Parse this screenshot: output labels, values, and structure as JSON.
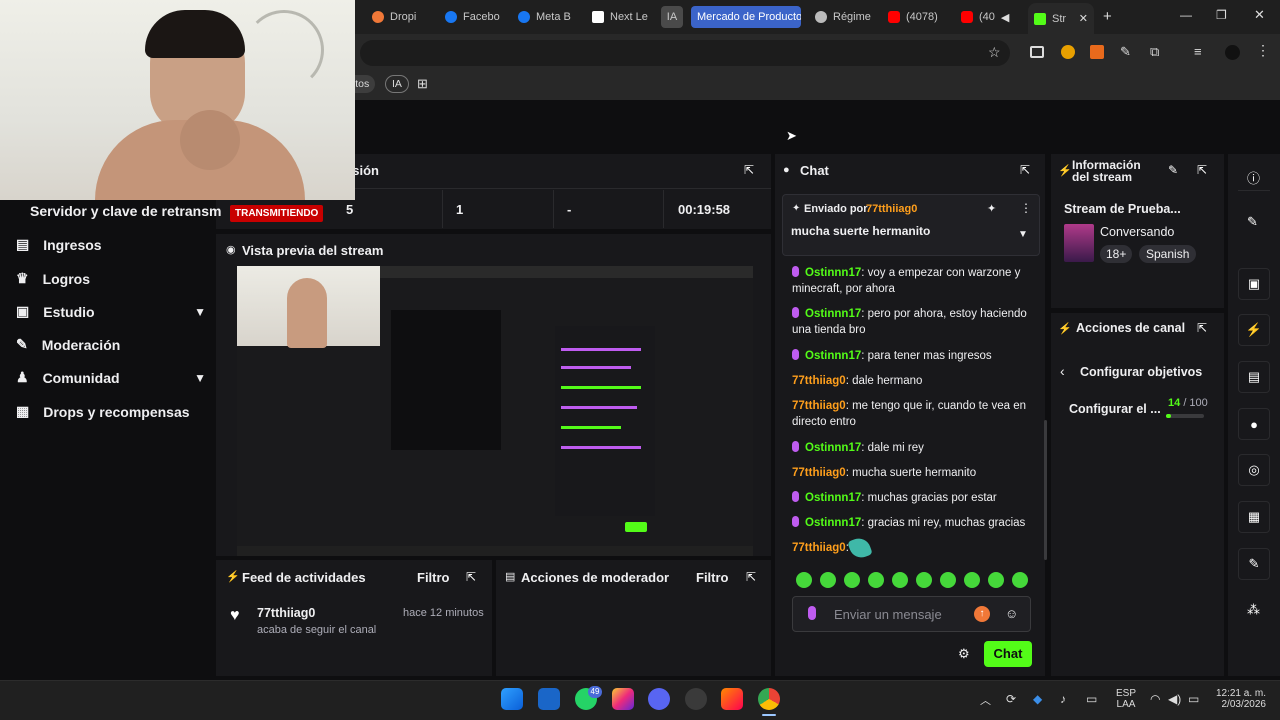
{
  "browser": {
    "tabs": [
      {
        "label": "Dropi",
        "color": "#f07838"
      },
      {
        "label": "Facebo",
        "color": "#1877f2"
      },
      {
        "label": "Meta B",
        "color": "#1877f2"
      },
      {
        "label": "Next Le",
        "color": "#ffffff"
      },
      {
        "label": "IA",
        "color": "#888888"
      },
      {
        "label": "Mercado de Producto",
        "color": "#3b64c9"
      },
      {
        "label": "Régime",
        "color": "#bbbbbb"
      },
      {
        "label": "(4078)",
        "color": "#ff0000"
      },
      {
        "label": "(40",
        "color": "#ff0000"
      },
      {
        "label": "Str",
        "color": "#53fc18"
      }
    ],
    "bookmarks": {
      "item1": "ctos",
      "item2": "IA"
    }
  },
  "session": {
    "title": "esión",
    "server_label": "Servidor y clave de retransm",
    "live_badge": "TRANSMITIENDO",
    "values": [
      "5",
      "1",
      "-",
      "00:19:58"
    ]
  },
  "sidebar": {
    "items": [
      {
        "label": "Ingresos",
        "icon": "coins-icon"
      },
      {
        "label": "Logros",
        "icon": "trophy-icon"
      },
      {
        "label": "Estudio",
        "icon": "studio-icon"
      },
      {
        "label": "Moderación",
        "icon": "wrench-icon"
      },
      {
        "label": "Comunidad",
        "icon": "community-icon"
      },
      {
        "label": "Drops y recompensas",
        "icon": "gift-icon"
      }
    ]
  },
  "preview": {
    "title": "Vista previa del stream"
  },
  "activity": {
    "title": "Feed de actividades",
    "filter": "Filtro",
    "item": {
      "user": "77tthiiag0",
      "time": "hace 12 minutos",
      "action": "acaba de seguir el canal"
    }
  },
  "moderator": {
    "title": "Acciones de moderador",
    "filter": "Filtro"
  },
  "chat": {
    "title": "Chat",
    "pinned": {
      "sent_by": "Enviado por",
      "user": "77tthiiag0",
      "text": "mucha suerte hermanito"
    },
    "messages": [
      {
        "user": "Ostinnn17",
        "text": "voy a empezar con warzone y minecraft, por ahora",
        "mod": true
      },
      {
        "user": "Ostinnn17",
        "text": "pero por ahora, estoy haciendo una tienda bro",
        "mod": true
      },
      {
        "user": "Ostinnn17",
        "text": "para tener mas ingresos",
        "mod": true
      },
      {
        "user": "77tthiiag0",
        "text": "dale hermano",
        "mod": false
      },
      {
        "user": "77tthiiag0",
        "text": "me tengo que ir, cuando te vea en directo entro",
        "mod": false
      },
      {
        "user": "Ostinnn17",
        "text": "dale mi rey",
        "mod": true
      },
      {
        "user": "77tthiiag0",
        "text": "mucha suerte hermanito",
        "mod": false
      },
      {
        "user": "Ostinnn17",
        "text": "muchas gracias por estar",
        "mod": true
      },
      {
        "user": "Ostinnn17",
        "text": "gracias mi rey, muchas gracias",
        "mod": true
      },
      {
        "user": "77tthiiag0",
        "text": "",
        "mod": false
      }
    ],
    "input_placeholder": "Enviar un mensaje",
    "send_label": "Chat",
    "colors": {
      "user_green": "#53fc18",
      "user_orange": "#ff9f1c",
      "accent": "#53fc18"
    }
  },
  "stream_info": {
    "title": "Información del stream",
    "stream_title": "Stream de Prueba...",
    "category": "Conversando",
    "tags": [
      "18+",
      "Spanish"
    ]
  },
  "channel_actions": {
    "title": "Acciones de canal",
    "back_label": "Configurar objetivos",
    "goal_label": "Configurar el ...",
    "goal_current": "14",
    "goal_total": "/ 100",
    "goal_fraction": 0.14
  },
  "taskbar": {
    "lang": "ESP",
    "layout": "LAA",
    "time": "12:21 a. m.",
    "date": "2/03/2026",
    "whatsapp_badge": "49"
  }
}
